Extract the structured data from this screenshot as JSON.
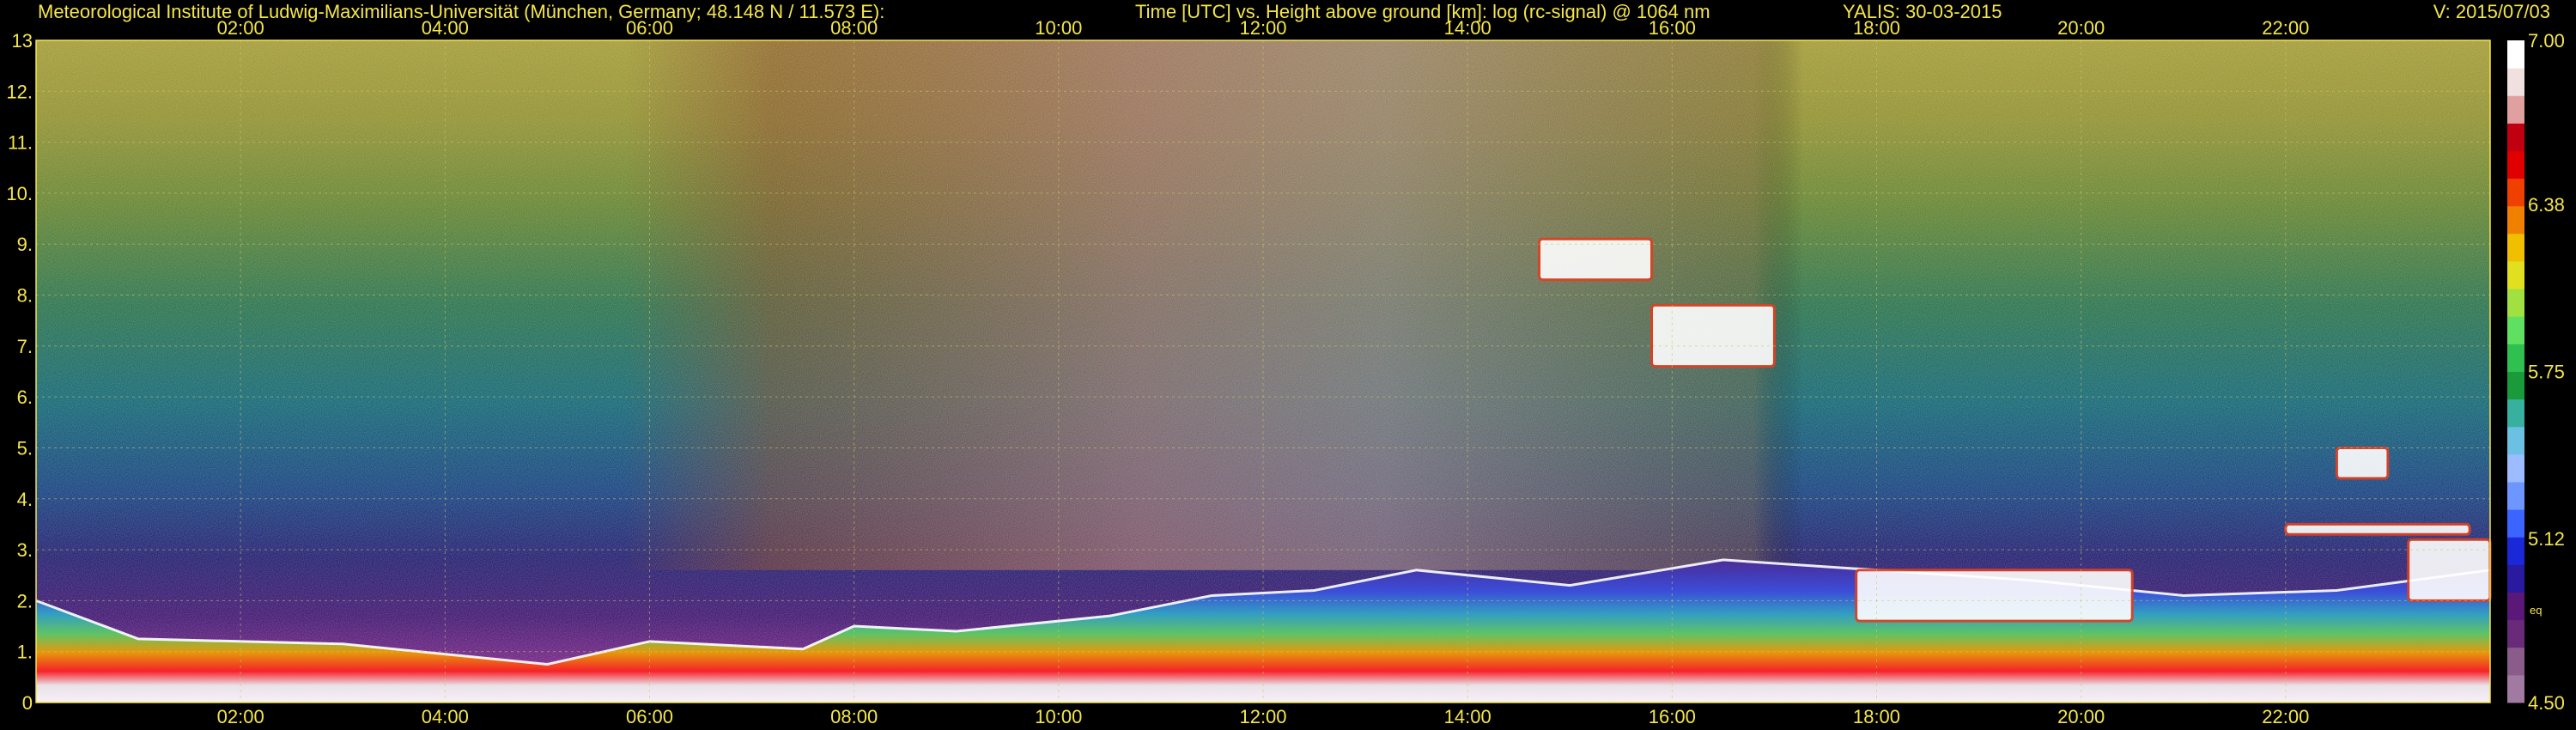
{
  "header": {
    "institute": "Meteorological Institute of Ludwig-Maximilians-Universität (München, Germany; 48.148 N / 11.573 E):",
    "title": "Time [UTC] vs. Height above ground [km]: log (rc-signal) @ 1064 nm",
    "station": "YALIS: 30-03-2015",
    "version": "V: 2015/07/03"
  },
  "chart_data": {
    "type": "heatmap",
    "title": "Time [UTC] vs. Height above ground [km]: log (rc-signal) @ 1064 nm",
    "x_axis": {
      "label": "Time [UTC]",
      "range_hours": [
        0,
        24
      ],
      "tick_labels": [
        "02:00",
        "04:00",
        "06:00",
        "08:00",
        "10:00",
        "12:00",
        "14:00",
        "16:00",
        "18:00",
        "20:00",
        "22:00"
      ],
      "tick_hours": [
        2,
        4,
        6,
        8,
        10,
        12,
        14,
        16,
        18,
        20,
        22
      ]
    },
    "y_axis": {
      "label": "Height above ground [km]",
      "range_km": [
        0,
        13
      ],
      "tick_labels": [
        "0",
        "1.",
        "2.",
        "3.",
        "4.",
        "5.",
        "6.",
        "7.",
        "8.",
        "9.",
        "10.",
        "11.",
        "12.",
        "13"
      ],
      "tick_values": [
        0,
        1,
        2,
        3,
        4,
        5,
        6,
        7,
        8,
        9,
        10,
        11,
        12,
        13
      ]
    },
    "grid": true,
    "colorbar": {
      "range": [
        4.5,
        7.0
      ],
      "tick_labels": [
        "7.00",
        "6.38",
        "5.75",
        "5.12",
        "4.50"
      ],
      "tick_values": [
        7.0,
        6.38,
        5.75,
        5.12,
        4.5
      ],
      "unit_label": "eq",
      "unit_value": 4.85,
      "colors_bottom_to_top": [
        "#a07aa0",
        "#8a5c8a",
        "#6a2a7a",
        "#5a1878",
        "#2a1aa0",
        "#1a28d8",
        "#3c64ff",
        "#6e96ff",
        "#9cbcff",
        "#6cc0e4",
        "#38b0a0",
        "#1a9a3a",
        "#30c050",
        "#60e060",
        "#a0e040",
        "#e0e020",
        "#f0c000",
        "#f08000",
        "#f04000",
        "#e00000",
        "#c00010",
        "#e0a0a0",
        "#f0e0e0",
        "#ffffff"
      ]
    },
    "boundary_layer_top_km": [
      {
        "time_h": 0.0,
        "height": 2.0
      },
      {
        "time_h": 1.0,
        "height": 1.25
      },
      {
        "time_h": 3.0,
        "height": 1.15
      },
      {
        "time_h": 5.0,
        "height": 0.75
      },
      {
        "time_h": 6.0,
        "height": 1.2
      },
      {
        "time_h": 7.5,
        "height": 1.05
      },
      {
        "time_h": 8.0,
        "height": 1.5
      },
      {
        "time_h": 9.0,
        "height": 1.4
      },
      {
        "time_h": 10.5,
        "height": 1.7
      },
      {
        "time_h": 11.5,
        "height": 2.1
      },
      {
        "time_h": 12.5,
        "height": 2.2
      },
      {
        "time_h": 13.5,
        "height": 2.6
      },
      {
        "time_h": 15.0,
        "height": 2.3
      },
      {
        "time_h": 16.5,
        "height": 2.8
      },
      {
        "time_h": 18.0,
        "height": 2.6
      },
      {
        "time_h": 19.5,
        "height": 2.4
      },
      {
        "time_h": 21.0,
        "height": 2.1
      },
      {
        "time_h": 22.5,
        "height": 2.2
      },
      {
        "time_h": 24.0,
        "height": 2.6
      }
    ],
    "cloud_layers_km": [
      {
        "start_h": 15.8,
        "end_h": 17.0,
        "bottom": 6.6,
        "top": 7.8
      },
      {
        "start_h": 14.7,
        "end_h": 15.8,
        "bottom": 8.3,
        "top": 9.1
      },
      {
        "start_h": 22.0,
        "end_h": 23.8,
        "bottom": 3.3,
        "top": 3.5
      },
      {
        "start_h": 22.5,
        "end_h": 23.0,
        "bottom": 4.4,
        "top": 5.0
      },
      {
        "start_h": 23.2,
        "end_h": 24.0,
        "bottom": 2.0,
        "top": 3.2
      },
      {
        "start_h": 17.8,
        "end_h": 20.5,
        "bottom": 1.6,
        "top": 2.6
      }
    ]
  }
}
